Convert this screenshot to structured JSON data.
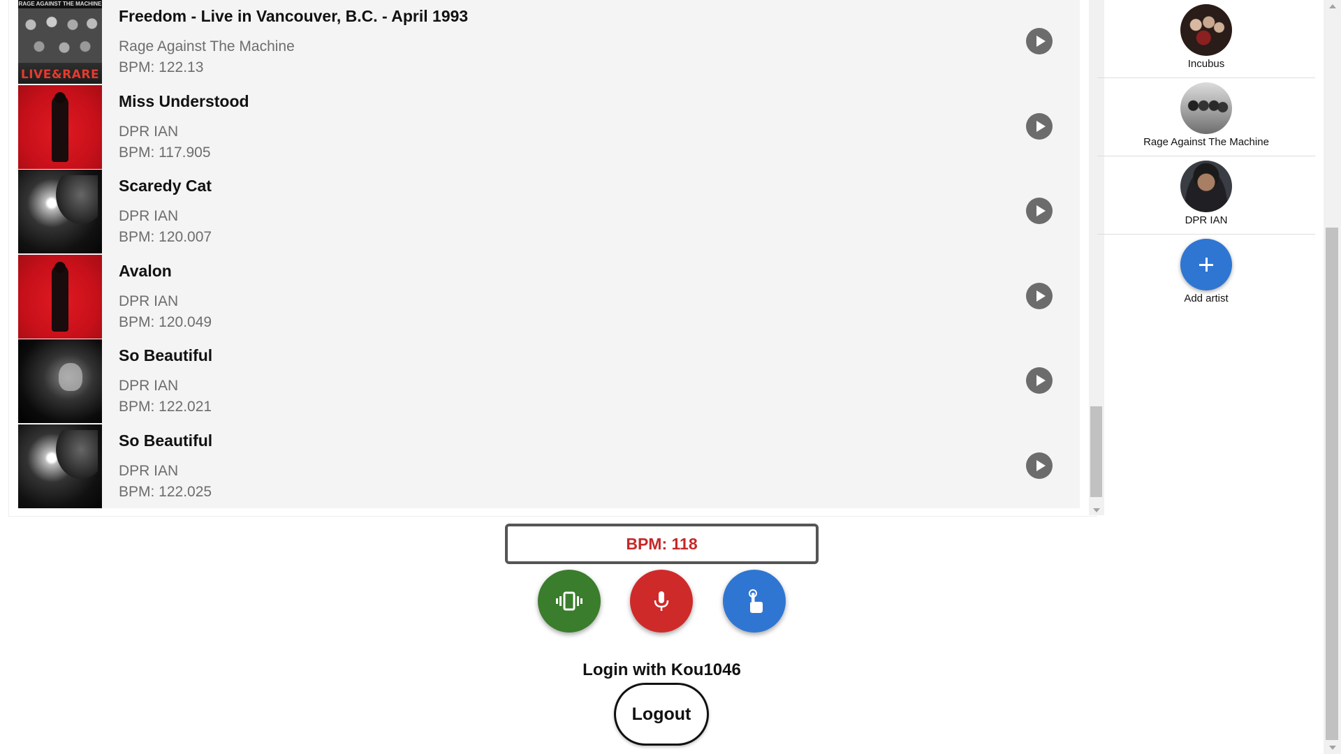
{
  "tracks": [
    {
      "title": "Freedom - Live in Vancouver, B.C. - April 1993",
      "artist": "Rage Against The Machine",
      "bpm": "BPM: 122.13",
      "cover_text": "LIVE&RARE",
      "cover_header": "RAGE AGAINST THE MACHINE"
    },
    {
      "title": "Miss Understood",
      "artist": "DPR IAN",
      "bpm": "BPM: 117.905"
    },
    {
      "title": "Scaredy Cat",
      "artist": "DPR IAN",
      "bpm": "BPM: 120.007"
    },
    {
      "title": "Avalon",
      "artist": "DPR IAN",
      "bpm": "BPM: 120.049"
    },
    {
      "title": "So Beautiful",
      "artist": "DPR IAN",
      "bpm": "BPM: 122.021"
    },
    {
      "title": "So Beautiful",
      "artist": "DPR IAN",
      "bpm": "BPM: 122.025"
    }
  ],
  "artists": [
    {
      "name": "Incubus"
    },
    {
      "name": "Rage Against The Machine"
    },
    {
      "name": "DPR IAN"
    }
  ],
  "add_artist_label": "Add artist",
  "bpm_display": "BPM: 118",
  "controls": {
    "vibrate_icon": "vibration-icon",
    "mic_icon": "microphone-icon",
    "tap_icon": "tap-hand-icon"
  },
  "login_text": "Login with Kou1046",
  "logout_label": "Logout",
  "colors": {
    "bpm_text": "#c62828",
    "vibrate_button": "#3a7d2c",
    "mic_button": "#cf2a2a",
    "tap_button": "#2f76d2",
    "add_button": "#2f76d2",
    "list_background": "#f4f4f4"
  }
}
